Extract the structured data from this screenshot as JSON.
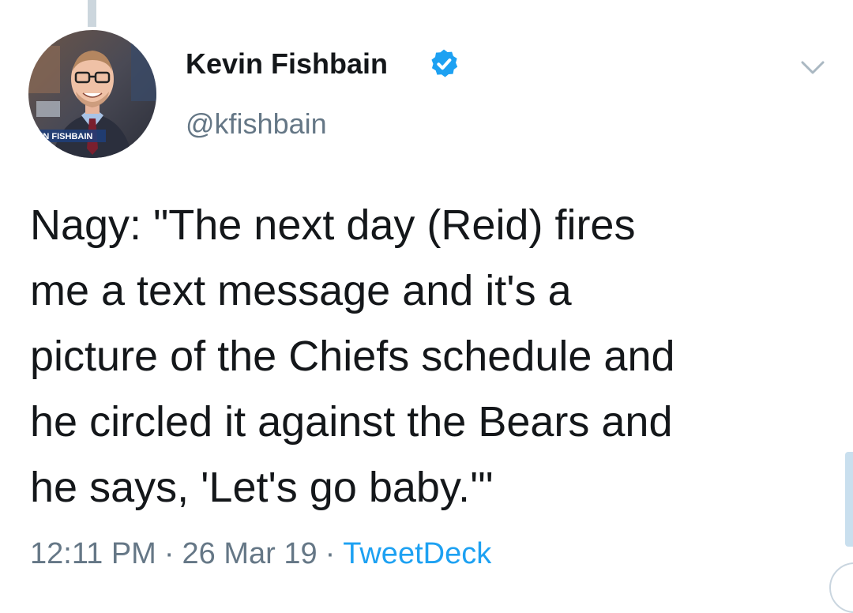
{
  "author": {
    "display_name": "Kevin Fishbain",
    "handle": "@kfishbain",
    "verified": true,
    "avatar_caption": "VIN FISHBAIN"
  },
  "tweet": {
    "lines": [
      "Nagy: \"The next day (Reid) fires",
      "me a text message and it's a",
      "picture of the Chiefs schedule and",
      "he circled it against the Bears and",
      "he says, 'Let's go baby.'\""
    ]
  },
  "meta": {
    "time": "12:11 PM",
    "date": "26 Mar 19",
    "separator": "·",
    "source": "TweetDeck"
  },
  "icons": {
    "verified": "verified-badge-icon",
    "more": "chevron-down-icon"
  },
  "colors": {
    "text": "#14171a",
    "secondary": "#657786",
    "accent": "#1da1f2",
    "thread_line": "#ccd6dd"
  }
}
